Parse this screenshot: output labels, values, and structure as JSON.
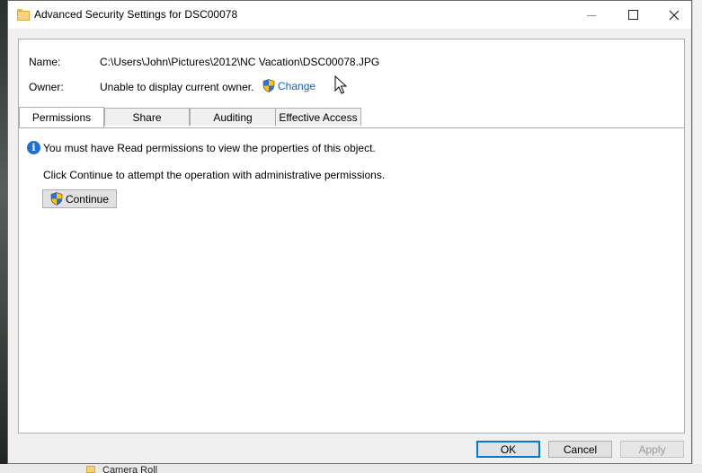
{
  "window": {
    "title": "Advanced Security Settings for DSC00078"
  },
  "fields": {
    "name_label": "Name:",
    "name_value": "C:\\Users\\John\\Pictures\\2012\\NC Vacation\\DSC00078.JPG",
    "owner_label": "Owner:",
    "owner_value": "Unable to display current owner.",
    "change_link": "Change"
  },
  "tabs": [
    {
      "label": "Permissions",
      "active": true
    },
    {
      "label": "Share",
      "active": false
    },
    {
      "label": "Auditing",
      "active": false
    },
    {
      "label": "Effective Access",
      "active": false
    }
  ],
  "permissions": {
    "info_message": "You must have Read permissions to view the properties of this object.",
    "continue_message": "Click Continue to attempt the operation with administrative permissions.",
    "continue_button": "Continue"
  },
  "buttons": {
    "ok": "OK",
    "cancel": "Cancel",
    "apply": "Apply"
  },
  "background": {
    "folder_label": "Camera Roll"
  },
  "icons": {
    "title": "folder-icon",
    "change": "uac-shield-icon",
    "info": "info-icon",
    "continue": "uac-shield-icon"
  },
  "colors": {
    "accent": "#0078d7",
    "link": "#1a5fb4",
    "info": "#1d6fd6"
  }
}
